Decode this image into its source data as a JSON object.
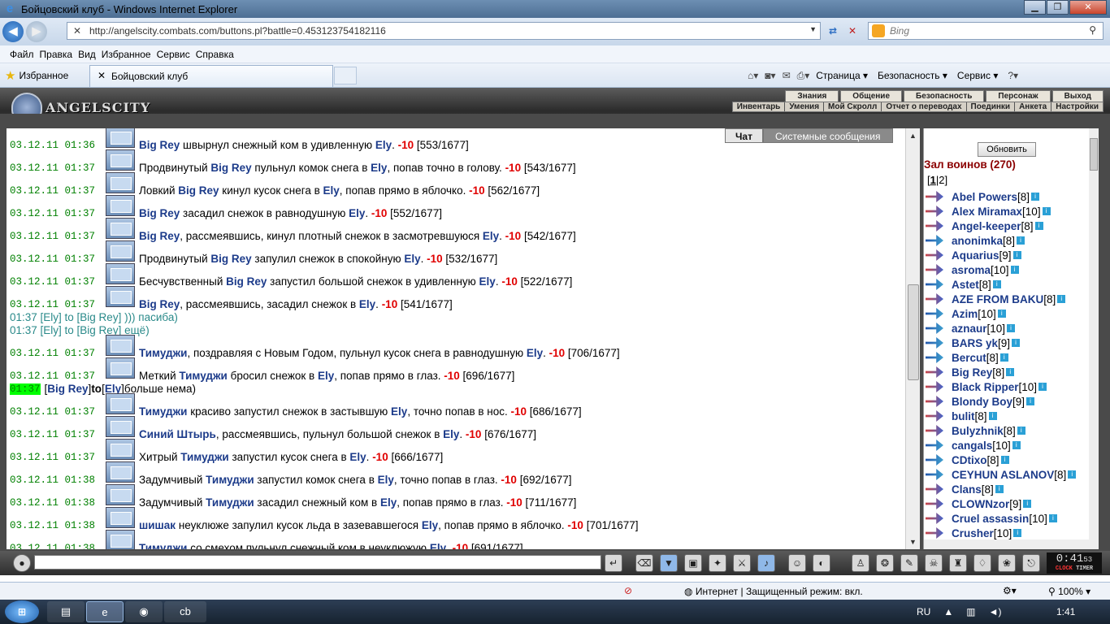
{
  "window": {
    "title": "Бойцовский клуб - Windows Internet Explorer"
  },
  "browser": {
    "url": "http://angelscity.combats.com/buttons.pl?battle=0.453123754182116",
    "search_placeholder": "Bing",
    "menu": [
      "Файл",
      "Правка",
      "Вид",
      "Избранное",
      "Сервис",
      "Справка"
    ],
    "favorites_label": "Избранное",
    "tab_title": "Бойцовский клуб",
    "commands": [
      "Страница",
      "Безопасность",
      "Сервис"
    ]
  },
  "game": {
    "logo_text": "ANGELSCITY",
    "topnav": [
      "Знания",
      "Общение",
      "Безопасность",
      "Персонаж",
      "Выход"
    ],
    "subnav": [
      "Инвентарь",
      "Умения",
      "Мой Скролл",
      "Отчет о переводах",
      "Поединки",
      "Анкета",
      "Настройки"
    ],
    "chat_tabs": [
      "Чат",
      "Системные сообщения"
    ]
  },
  "chat_lines": [
    {
      "ts": "03.12.11 01:36",
      "snow": true,
      "pre": "",
      "a": "Big Rey",
      "mid": " швырнул снежный ком в удивленную ",
      "b": "Ely",
      "post": ". ",
      "dmg": "-10",
      "hp": " [553/1677]"
    },
    {
      "ts": "03.12.11 01:37",
      "snow": true,
      "pre": "Продвинутый ",
      "a": "Big Rey",
      "mid": " пульнул комок снега в ",
      "b": "Ely",
      "post": ", попав точно в голову. ",
      "dmg": "-10",
      "hp": " [543/1677]"
    },
    {
      "ts": "03.12.11 01:37",
      "snow": true,
      "pre": "Ловкий ",
      "a": "Big Rey",
      "mid": " кинул кусок снега в ",
      "b": "Ely",
      "post": ", попав прямо в яблочко. ",
      "dmg": "-10",
      "hp": " [562/1677]"
    },
    {
      "ts": "03.12.11 01:37",
      "snow": true,
      "pre": "",
      "a": "Big Rey",
      "mid": " засадил снежок в равнодушную ",
      "b": "Ely",
      "post": ". ",
      "dmg": "-10",
      "hp": " [552/1677]"
    },
    {
      "ts": "03.12.11 01:37",
      "snow": true,
      "pre": "",
      "a": "Big Rey",
      "mid": ", рассмеявшись, кинул плотный снежок в засмотревшуюся ",
      "b": "Ely",
      "post": ". ",
      "dmg": "-10",
      "hp": " [542/1677]"
    },
    {
      "ts": "03.12.11 01:37",
      "snow": true,
      "pre": "Продвинутый ",
      "a": "Big Rey",
      "mid": " запулил снежок в спокойную ",
      "b": "Ely",
      "post": ". ",
      "dmg": "-10",
      "hp": " [532/1677]"
    },
    {
      "ts": "03.12.11 01:37",
      "snow": true,
      "pre": "Бесчувственный ",
      "a": "Big Rey",
      "mid": " запустил большой снежок в удивленную ",
      "b": "Ely",
      "post": ". ",
      "dmg": "-10",
      "hp": " [522/1677]"
    },
    {
      "ts": "03.12.11 01:37",
      "snow": true,
      "pre": "",
      "a": "Big Rey",
      "mid": ", рассмеявшись, засадил снежок в ",
      "b": "Ely",
      "post": ". ",
      "dmg": "-10",
      "hp": " [541/1677]"
    },
    {
      "private": true,
      "text": "01:37 [Ely] to [Big Rey] ))) пасиба)"
    },
    {
      "private": true,
      "text": "01:37 [Ely] to [Big Rey] ещё)"
    },
    {
      "ts": "03.12.11 01:37",
      "snow": true,
      "pre": "",
      "a": "Тимуджи",
      "mid": ", поздравляя с Новым Годом, пульнул кусок снега в равнодушную ",
      "b": "Ely",
      "post": ". ",
      "dmg": "-10",
      "hp": " [706/1677]"
    },
    {
      "ts": "03.12.11 01:37",
      "snow": true,
      "pre": "Меткий ",
      "a": "Тимуджи",
      "mid": " бросил снежок в ",
      "b": "Ely",
      "post": ", попав прямо в глаз. ",
      "dmg": "-10",
      "hp": " [696/1677]"
    },
    {
      "highlight": true,
      "time": "01:37",
      "from": "Big Rey",
      "to_word": " to ",
      "to": "Ely",
      "text": " больше нема)"
    },
    {
      "ts": "03.12.11 01:37",
      "snow": true,
      "pre": "",
      "a": "Тимуджи",
      "mid": " красиво запустил снежок в застывшую ",
      "b": "Ely",
      "post": ", точно попав в нос. ",
      "dmg": "-10",
      "hp": " [686/1677]"
    },
    {
      "ts": "03.12.11 01:37",
      "snow": true,
      "pre": "",
      "a": "Синий Штырь",
      "mid": ", рассмеявшись, пульнул большой снежок в ",
      "b": "Ely",
      "post": ". ",
      "dmg": "-10",
      "hp": " [676/1677]"
    },
    {
      "ts": "03.12.11 01:37",
      "snow": true,
      "pre": "Хитрый ",
      "a": "Тимуджи",
      "mid": " запустил кусок снега в ",
      "b": "Ely",
      "post": ". ",
      "dmg": "-10",
      "hp": " [666/1677]"
    },
    {
      "ts": "03.12.11 01:38",
      "snow": true,
      "pre": "Задумчивый ",
      "a": "Тимуджи",
      "mid": " запустил комок снега в ",
      "b": "Ely",
      "post": ", точно попав в глаз. ",
      "dmg": "-10",
      "hp": " [692/1677]"
    },
    {
      "ts": "03.12.11 01:38",
      "snow": true,
      "pre": "Задумчивый ",
      "a": "Тимуджи",
      "mid": " засадил снежный ком в ",
      "b": "Ely",
      "post": ", попав прямо в глаз. ",
      "dmg": "-10",
      "hp": " [711/1677]"
    },
    {
      "ts": "03.12.11 01:38",
      "snow": true,
      "pre": "",
      "a": "шишак",
      "mid": " неуклюже запулил кусок льда в зазевавшегося ",
      "b": "Ely",
      "post": ", попав прямо в яблочко. ",
      "dmg": "-10",
      "hp": " [701/1677]"
    },
    {
      "ts": "03.12.11 01:38",
      "snow": true,
      "pre": "",
      "a": "Тимуджи",
      "mid": " со смехом пульнул снежный ком в неуклюжую ",
      "b": "Ely",
      "post": ". ",
      "dmg": "-10",
      "hp": " [691/1677]"
    }
  ],
  "sidebar": {
    "refresh_label": "Обновить",
    "hall_title": "Зал воинов (270)",
    "pages": [
      "1",
      "2"
    ],
    "players": [
      {
        "name": "Abel Powers",
        "level": "[8]",
        "side": "a"
      },
      {
        "name": "Alex Miramax",
        "level": "[10]",
        "side": "a"
      },
      {
        "name": "Angel-keeper",
        "level": "[8]",
        "side": "a"
      },
      {
        "name": "anonimka",
        "level": "[8]",
        "side": "b"
      },
      {
        "name": "Aquarius",
        "level": "[9]",
        "side": "a"
      },
      {
        "name": "asroma",
        "level": "[10]",
        "side": "a"
      },
      {
        "name": "Astet",
        "level": "[8]",
        "side": "b"
      },
      {
        "name": "AZE FROM BAKU",
        "level": "[8]",
        "side": "a"
      },
      {
        "name": "Azim",
        "level": "[10]",
        "side": "b"
      },
      {
        "name": "aznaur",
        "level": "[10]",
        "side": "b"
      },
      {
        "name": "BARS yk",
        "level": "[9]",
        "side": "b"
      },
      {
        "name": "Bercut",
        "level": "[8]",
        "side": "b"
      },
      {
        "name": "Big Rey",
        "level": "[8]",
        "side": "a"
      },
      {
        "name": "Black Ripper",
        "level": "[10]",
        "side": "a"
      },
      {
        "name": "Blondy Boy",
        "level": "[9]",
        "side": "a"
      },
      {
        "name": "bulit",
        "level": "[8]",
        "side": "a"
      },
      {
        "name": "Bulyzhnik",
        "level": "[8]",
        "side": "a"
      },
      {
        "name": "cangals",
        "level": "[10]",
        "side": "b"
      },
      {
        "name": "CDtixo",
        "level": "[8]",
        "side": "b"
      },
      {
        "name": "CEYHUN ASLANOV",
        "level": "[8]",
        "side": "b"
      },
      {
        "name": "Clans",
        "level": "[8]",
        "side": "a"
      },
      {
        "name": "CLOWNzor",
        "level": "[9]",
        "side": "a"
      },
      {
        "name": "Cruel assassin",
        "level": "[10]",
        "side": "a"
      },
      {
        "name": "Crusher",
        "level": "[10]",
        "side": "a"
      }
    ]
  },
  "clock": {
    "time": "0:41",
    "sec": "53",
    "labels": [
      "CLOCK",
      "TIMER"
    ]
  },
  "statusbar": {
    "zone": "Интернет | Защищенный режим: вкл.",
    "zoom": "100%"
  },
  "taskbar": {
    "lang": "RU",
    "time": "1:41"
  }
}
